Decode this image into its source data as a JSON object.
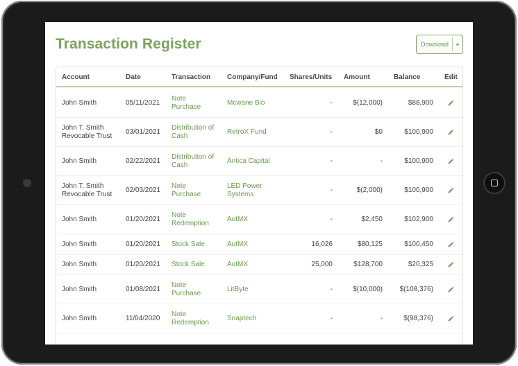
{
  "page": {
    "title": "Transaction Register",
    "download_label": "Download"
  },
  "table": {
    "headers": {
      "account": "Account",
      "date": "Date",
      "transaction": "Transaction",
      "company": "Company/Fund",
      "shares": "Shares/Units",
      "amount": "Amount",
      "balance": "Balance",
      "edit": "Edit"
    },
    "rows": [
      {
        "account": [
          "John Smith"
        ],
        "date": "05/11/2021",
        "transaction": [
          "Note",
          "Purchase"
        ],
        "company": [
          "Mcwane Bio"
        ],
        "shares": "-",
        "amount": "$(12,000)",
        "balance": "$88,900"
      },
      {
        "account": [
          "John T. Smith",
          "Revocable Trust"
        ],
        "date": "03/01/2021",
        "transaction": [
          "Distribution of",
          "Cash"
        ],
        "company": [
          "RetroX Fund"
        ],
        "shares": "-",
        "amount": "$0",
        "balance": "$100,900"
      },
      {
        "account": [
          "John Smith"
        ],
        "date": "02/22/2021",
        "transaction": [
          "Distribution of",
          "Cash"
        ],
        "company": [
          "Antica Capital"
        ],
        "shares": "-",
        "amount": "-",
        "balance": "$100,900"
      },
      {
        "account": [
          "John T. Smith",
          "Revocable Trust"
        ],
        "date": "02/03/2021",
        "transaction": [
          "Note",
          "Purchase"
        ],
        "company": [
          "LED Power",
          "Systems"
        ],
        "shares": "-",
        "amount": "$(2,000)",
        "balance": "$100,900"
      },
      {
        "account": [
          "John Smith"
        ],
        "date": "01/20/2021",
        "transaction": [
          "Note",
          "Redemption"
        ],
        "company": [
          "AutMX"
        ],
        "shares": "-",
        "amount": "$2,450",
        "balance": "$102,900"
      },
      {
        "account": [
          "John Smith"
        ],
        "date": "01/20/2021",
        "transaction": [
          "Stock Sale"
        ],
        "company": [
          "AutMX"
        ],
        "shares": "16,026",
        "amount": "$80,125",
        "balance": "$100,450"
      },
      {
        "account": [
          "John Smith"
        ],
        "date": "01/20/2021",
        "transaction": [
          "Stock Sale"
        ],
        "company": [
          "AutMX"
        ],
        "shares": "25,000",
        "amount": "$128,700",
        "balance": "$20,325"
      },
      {
        "account": [
          "John Smith"
        ],
        "date": "01/08/2021",
        "transaction": [
          "Note",
          "Purchase"
        ],
        "company": [
          "LitByte"
        ],
        "shares": "-",
        "amount": "$(10,000)",
        "balance": "$(108,376)"
      },
      {
        "account": [
          "John Smith"
        ],
        "date": "11/04/2020",
        "transaction": [
          "Note",
          "Redemption"
        ],
        "company": [
          "Snaptech"
        ],
        "shares": "-",
        "amount": "-",
        "balance": "$(98,376)"
      }
    ]
  },
  "colors": {
    "accent": "#7aa35e",
    "link": "#6a9a4f",
    "header_rule": "#b9d4a6"
  },
  "icons": {
    "edit": "pencil-icon"
  }
}
